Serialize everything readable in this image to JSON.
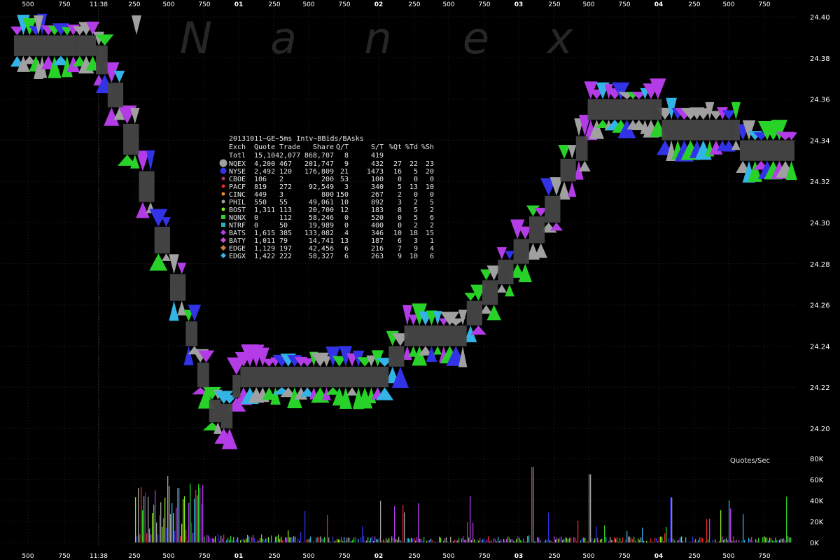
{
  "chart_data": {
    "type": "line",
    "title": "20131011~GE~5ms Intv~BBids/BAsks",
    "watermark": [
      "N",
      "a",
      "n",
      "e",
      "x"
    ],
    "x_tick_labels": [
      "500",
      "750",
      "11:38",
      "250",
      "500",
      "750",
      "01",
      "250",
      "500",
      "750",
      "02",
      "250",
      "500",
      "750",
      "03",
      "250",
      "500",
      "750",
      "04",
      "250",
      "500",
      "750"
    ],
    "x_major_labels": [
      "01",
      "02",
      "03",
      "04"
    ],
    "ylim": [
      24.19,
      24.4
    ],
    "y_ticks": [
      "24.40",
      "24.38",
      "24.36",
      "24.34",
      "24.32",
      "24.30",
      "24.28",
      "24.26",
      "24.24",
      "24.22",
      "24.20"
    ],
    "volume_label": "Quotes/Sec",
    "volume_ticks": [
      "80K",
      "60K",
      "40K",
      "20K",
      "0K"
    ],
    "volume_ylim": [
      0,
      80000
    ],
    "colors": {
      "NQEX": "#a0a0a0",
      "NYSE": "#3232e6",
      "CBOE": "#b4327a",
      "PACF": "#e62828",
      "CINC": "#f08c28",
      "PHIL": "#a0a0a0",
      "BOST": "#8ce61e",
      "NQNX": "#28d228",
      "NTRF": "#28b4b4",
      "BATS": "#b43ce6",
      "BATY": "#d250d2",
      "EDGE": "#c8823c",
      "EDGX": "#32b4e6",
      "spread": "#464646"
    },
    "table": {
      "header": [
        "Exch",
        "Quote",
        "Trade",
        "Share",
        "Q/T",
        "S/T",
        "%Qt",
        "%Td",
        "%Sh"
      ],
      "total": [
        "Totl",
        "15,104",
        "2,077",
        "868,707",
        "8",
        "419",
        "",
        "",
        ""
      ],
      "rows": [
        {
          "marker": "circle-lg",
          "color": "#a0a0a0",
          "cells": [
            "NQEX",
            "4,200",
            "467",
            "201,747",
            "9",
            "432",
            "27",
            "22",
            "23"
          ]
        },
        {
          "marker": "circle",
          "color": "#3232e6",
          "cells": [
            "NYSE",
            "2,492",
            "120",
            "176,809",
            "21",
            "1473",
            "16",
            "5",
            "20"
          ]
        },
        {
          "marker": "dot",
          "color": "#b4327a",
          "cells": [
            "CBOE",
            "106",
            "2",
            "200",
            "53",
            "100",
            "0",
            "0",
            "0"
          ]
        },
        {
          "marker": "dot",
          "color": "#e62828",
          "cells": [
            "PACF",
            "819",
            "272",
            "92,549",
            "3",
            "340",
            "5",
            "13",
            "10"
          ]
        },
        {
          "marker": "dot",
          "color": "#f08c28",
          "cells": [
            "CINC",
            "449",
            "3",
            "800",
            "150",
            "267",
            "2",
            "0",
            "0"
          ]
        },
        {
          "marker": "dot",
          "color": "#a0a0a0",
          "cells": [
            "PHIL",
            "550",
            "55",
            "49,061",
            "10",
            "892",
            "3",
            "2",
            "5"
          ]
        },
        {
          "marker": "dot",
          "color": "#8ce61e",
          "cells": [
            "BOST",
            "1,311",
            "113",
            "20,700",
            "12",
            "183",
            "8",
            "5",
            "2"
          ]
        },
        {
          "marker": "square",
          "color": "#28d228",
          "cells": [
            "NQNX",
            "0",
            "112",
            "58,246",
            "0",
            "520",
            "0",
            "5",
            "6"
          ]
        },
        {
          "marker": "square",
          "color": "#28b4b4",
          "cells": [
            "NTRF",
            "0",
            "50",
            "19,989",
            "0",
            "400",
            "0",
            "2",
            "2"
          ]
        },
        {
          "marker": "diamond",
          "color": "#b43ce6",
          "cells": [
            "BATS",
            "1,615",
            "385",
            "133,082",
            "4",
            "346",
            "10",
            "18",
            "15"
          ]
        },
        {
          "marker": "diamond",
          "color": "#d250d2",
          "cells": [
            "BATY",
            "1,011",
            "79",
            "14,741",
            "13",
            "187",
            "6",
            "3",
            "1"
          ]
        },
        {
          "marker": "diamond",
          "color": "#c8823c",
          "cells": [
            "EDGE",
            "1,129",
            "197",
            "42,456",
            "6",
            "216",
            "7",
            "9",
            "4"
          ]
        },
        {
          "marker": "diamond",
          "color": "#32b4e6",
          "cells": [
            "EDGX",
            "1,422",
            "222",
            "58,327",
            "6",
            "263",
            "9",
            "10",
            "6"
          ]
        }
      ]
    },
    "nbbo_segments": [
      {
        "t": 0.0,
        "bid": 24.381,
        "ask": 24.391
      },
      {
        "t": 0.08,
        "bid": 24.381,
        "ask": 24.391
      },
      {
        "t": 0.105,
        "bid": 24.372,
        "ask": 24.386
      },
      {
        "t": 0.12,
        "bid": 24.356,
        "ask": 24.368
      },
      {
        "t": 0.14,
        "bid": 24.333,
        "ask": 24.348
      },
      {
        "t": 0.16,
        "bid": 24.31,
        "ask": 24.325
      },
      {
        "t": 0.18,
        "bid": 24.285,
        "ask": 24.298
      },
      {
        "t": 0.2,
        "bid": 24.262,
        "ask": 24.275
      },
      {
        "t": 0.22,
        "bid": 24.24,
        "ask": 24.252
      },
      {
        "t": 0.235,
        "bid": 24.22,
        "ask": 24.232
      },
      {
        "t": 0.25,
        "bid": 24.203,
        "ask": 24.214
      },
      {
        "t": 0.265,
        "bid": 24.2,
        "ask": 24.212
      },
      {
        "t": 0.28,
        "bid": 24.215,
        "ask": 24.226
      },
      {
        "t": 0.29,
        "bid": 24.22,
        "ask": 24.23
      },
      {
        "t": 0.47,
        "bid": 24.22,
        "ask": 24.23
      },
      {
        "t": 0.48,
        "bid": 24.23,
        "ask": 24.24
      },
      {
        "t": 0.5,
        "bid": 24.24,
        "ask": 24.25
      },
      {
        "t": 0.57,
        "bid": 24.24,
        "ask": 24.25
      },
      {
        "t": 0.58,
        "bid": 24.25,
        "ask": 24.262
      },
      {
        "t": 0.6,
        "bid": 24.26,
        "ask": 24.272
      },
      {
        "t": 0.62,
        "bid": 24.27,
        "ask": 24.282
      },
      {
        "t": 0.64,
        "bid": 24.28,
        "ask": 24.292
      },
      {
        "t": 0.66,
        "bid": 24.29,
        "ask": 24.303
      },
      {
        "t": 0.68,
        "bid": 24.3,
        "ask": 24.313
      },
      {
        "t": 0.7,
        "bid": 24.32,
        "ask": 24.331
      },
      {
        "t": 0.72,
        "bid": 24.33,
        "ask": 24.342
      },
      {
        "t": 0.735,
        "bid": 24.35,
        "ask": 24.36
      },
      {
        "t": 0.82,
        "bid": 24.35,
        "ask": 24.36
      },
      {
        "t": 0.83,
        "bid": 24.34,
        "ask": 24.35
      },
      {
        "t": 0.92,
        "bid": 24.34,
        "ask": 24.35
      },
      {
        "t": 0.93,
        "bid": 24.33,
        "ask": 24.34
      },
      {
        "t": 1.0,
        "bid": 24.33,
        "ask": 24.34
      }
    ]
  }
}
